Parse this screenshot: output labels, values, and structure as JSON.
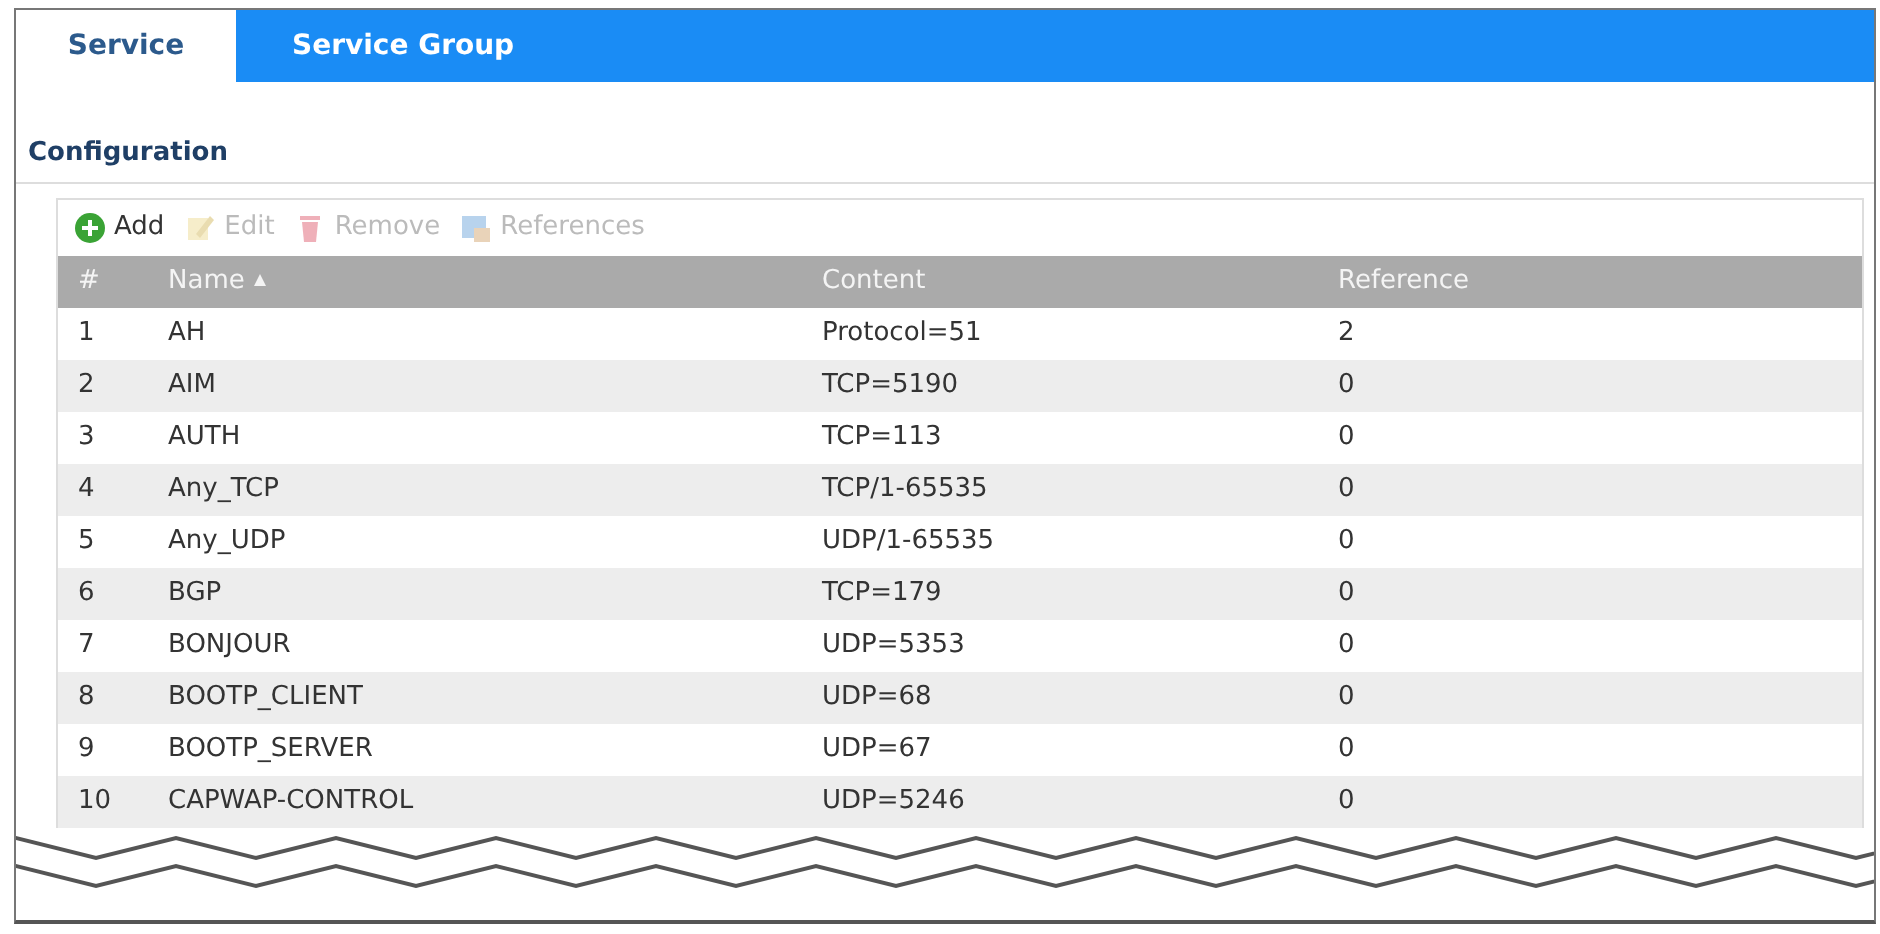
{
  "tabs": [
    {
      "label": "Service",
      "selected": true
    },
    {
      "label": "Service Group",
      "selected": false
    }
  ],
  "section_title": "Configuration",
  "toolbar": [
    {
      "label": "Add",
      "kind": "add",
      "disabled": false
    },
    {
      "label": "Edit",
      "kind": "edit",
      "disabled": true
    },
    {
      "label": "Remove",
      "kind": "remove",
      "disabled": true
    },
    {
      "label": "References",
      "kind": "references",
      "disabled": true
    }
  ],
  "table": {
    "columns": [
      {
        "label": "#"
      },
      {
        "label": "Name",
        "sorted": true
      },
      {
        "label": "Content"
      },
      {
        "label": "Reference"
      }
    ],
    "rows": [
      [
        "1",
        "AH",
        "Protocol=51",
        "2"
      ],
      [
        "2",
        "AIM",
        "TCP=5190",
        "0"
      ],
      [
        "3",
        "AUTH",
        "TCP=113",
        "0"
      ],
      [
        "4",
        "Any_TCP",
        "TCP/1-65535",
        "0"
      ],
      [
        "5",
        "Any_UDP",
        "UDP/1-65535",
        "0"
      ],
      [
        "6",
        "BGP",
        "TCP=179",
        "0"
      ],
      [
        "7",
        "BONJOUR",
        "UDP=5353",
        "0"
      ],
      [
        "8",
        "BOOTP_CLIENT",
        "UDP=68",
        "0"
      ],
      [
        "9",
        "BOOTP_SERVER",
        "UDP=67",
        "0"
      ],
      [
        "10",
        "CAPWAP-CONTROL",
        "UDP=5246",
        "0"
      ]
    ]
  }
}
